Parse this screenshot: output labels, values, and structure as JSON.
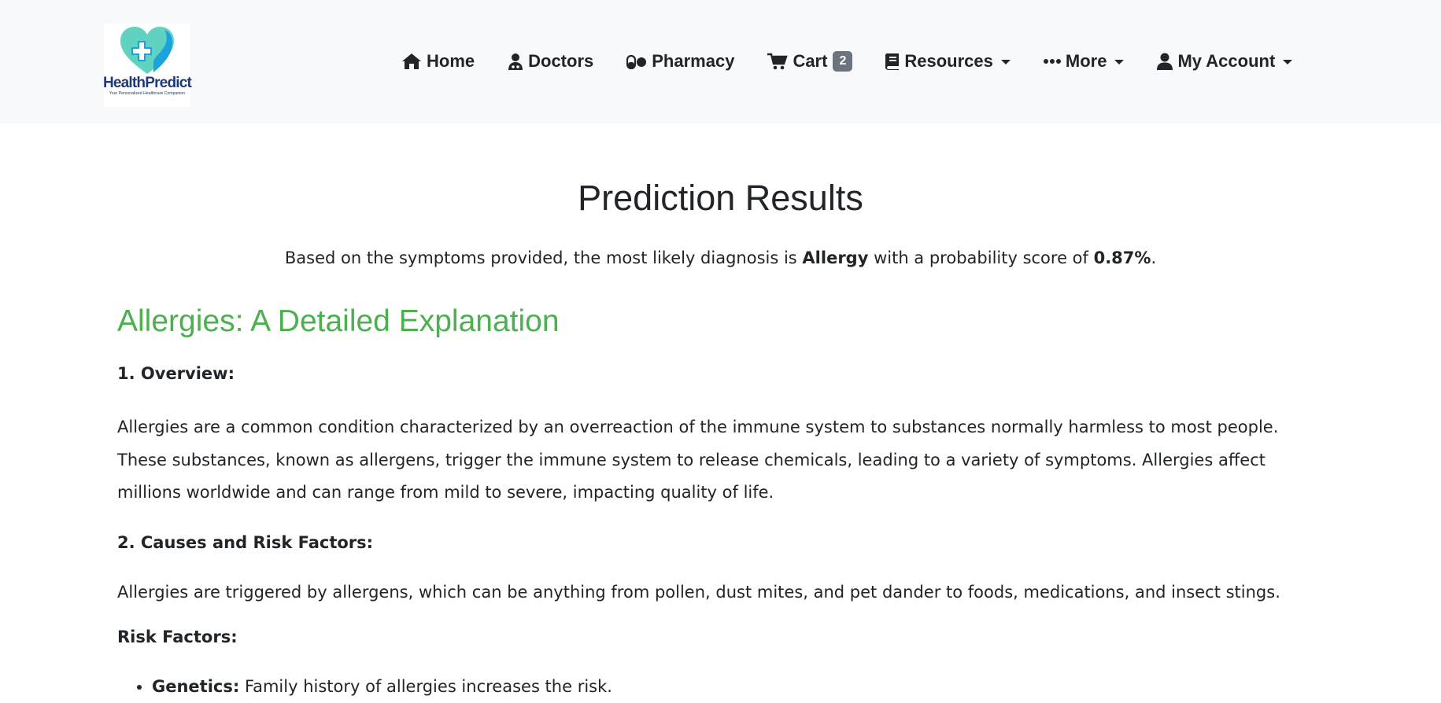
{
  "brand": {
    "name": "HealthPredict",
    "tagline": "Your Personalized Healthcare Companion"
  },
  "nav": {
    "home": "Home",
    "doctors": "Doctors",
    "pharmacy": "Pharmacy",
    "cart": "Cart",
    "cart_count": "2",
    "resources": "Resources",
    "more": "More",
    "account": "My Account"
  },
  "page": {
    "title": "Prediction Results",
    "summary_prefix": "Based on the symptoms provided, the most likely diagnosis is ",
    "diagnosis": "Allergy",
    "summary_middle": " with a probability score of ",
    "score": "0.87%",
    "summary_suffix": "."
  },
  "article": {
    "title": "Allergies: A Detailed Explanation",
    "overview_heading": "1. Overview:",
    "overview_text": "Allergies are a common condition characterized by an overreaction of the immune system to substances normally harmless to most people. These substances, known as allergens, trigger the immune system to release chemicals, leading to a variety of symptoms. Allergies affect millions worldwide and can range from mild to severe, impacting quality of life.",
    "causes_heading": "2. Causes and Risk Factors:",
    "causes_text": "Allergies are triggered by allergens, which can be anything from pollen, dust mites, and pet dander to foods, medications, and insect stings.",
    "risk_heading": "Risk Factors:",
    "risk_items": [
      {
        "term": "Genetics:",
        "text": " Family history of allergies increases the risk."
      }
    ]
  },
  "colors": {
    "accent_green": "#4caf50",
    "navbar_bg": "#f8f9fa",
    "badge_bg": "#6c757d",
    "brand_navy": "#1e3a78",
    "brand_teal": "#5fd3c0",
    "brand_blue": "#1aa3dd"
  },
  "icons": [
    "home-icon",
    "doctor-icon",
    "pills-icon",
    "cart-icon",
    "book-icon",
    "ellipsis-icon",
    "user-icon",
    "caret-down-icon"
  ]
}
